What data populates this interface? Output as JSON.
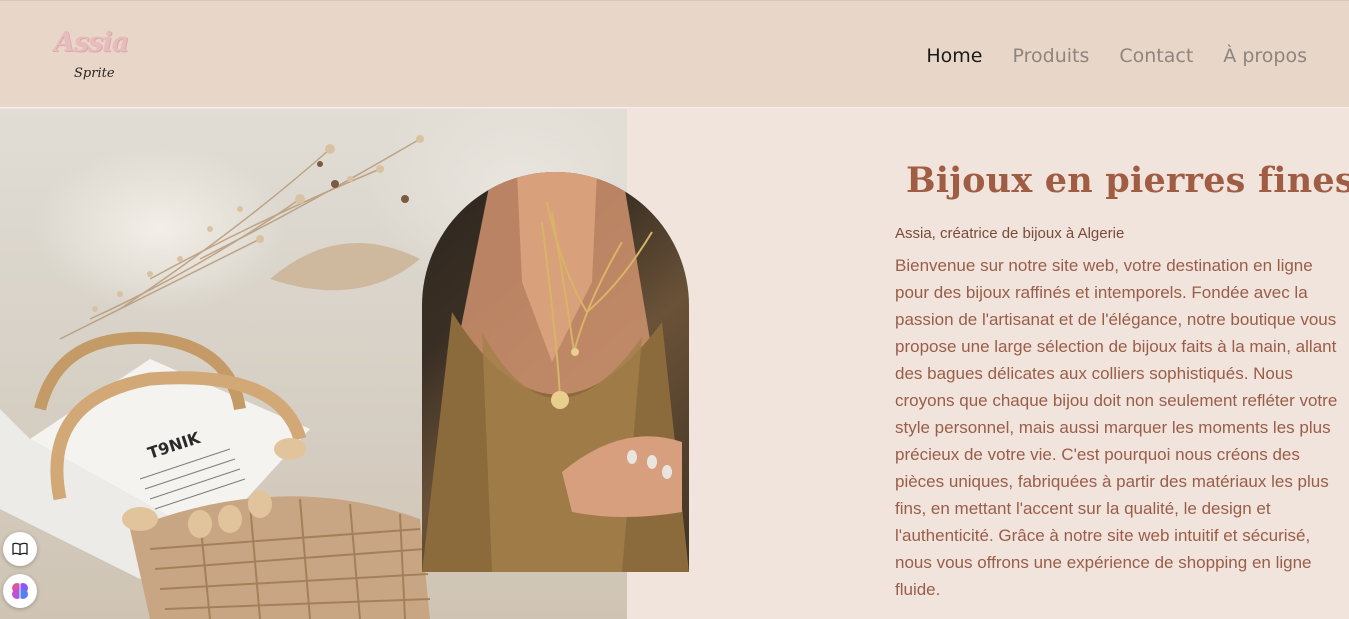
{
  "header": {
    "logo": {
      "main": "Assia",
      "sub": "Sprite"
    },
    "nav": [
      {
        "label": "Home",
        "active": true
      },
      {
        "label": "Produits",
        "active": false
      },
      {
        "label": "Contact",
        "active": false
      },
      {
        "label": "À propos",
        "active": false
      }
    ]
  },
  "hero": {
    "title": "Bijoux en pierres fines",
    "subtitle": "Assia, créatrice de bijoux à Algerie",
    "paragraph": "Bienvenue sur notre site web, votre destination en ligne pour des bijoux raffinés et intemporels. Fondée avec la passion de l'artisanat et de l'élégance, notre boutique vous propose une large sélection de bijoux faits à la main, allant des bagues délicates aux colliers sophistiqués. Nous croyons que chaque bijou doit non seulement refléter votre style personnel, mais aussi marquer les moments les plus précieux de votre vie. C'est pourquoi nous créons des pièces uniques, fabriquées à partir des matériaux les plus fins, en mettant l'accent sur la qualité, le design et l'authenticité. Grâce à notre site web intuitif et sécurisé, nous vous offrons une expérience de shopping en ligne fluide.",
    "bag_label": "T9NIK"
  },
  "floating_buttons": [
    {
      "icon": "book-icon"
    },
    {
      "icon": "brain-icon"
    }
  ],
  "colors": {
    "header_bg": "#e8d7c8",
    "page_bg": "#f1e4dc",
    "title": "#a05d43",
    "text": "#9a5d49",
    "nav_active": "#1b1b1b",
    "nav_inactive": "#8f847e"
  }
}
